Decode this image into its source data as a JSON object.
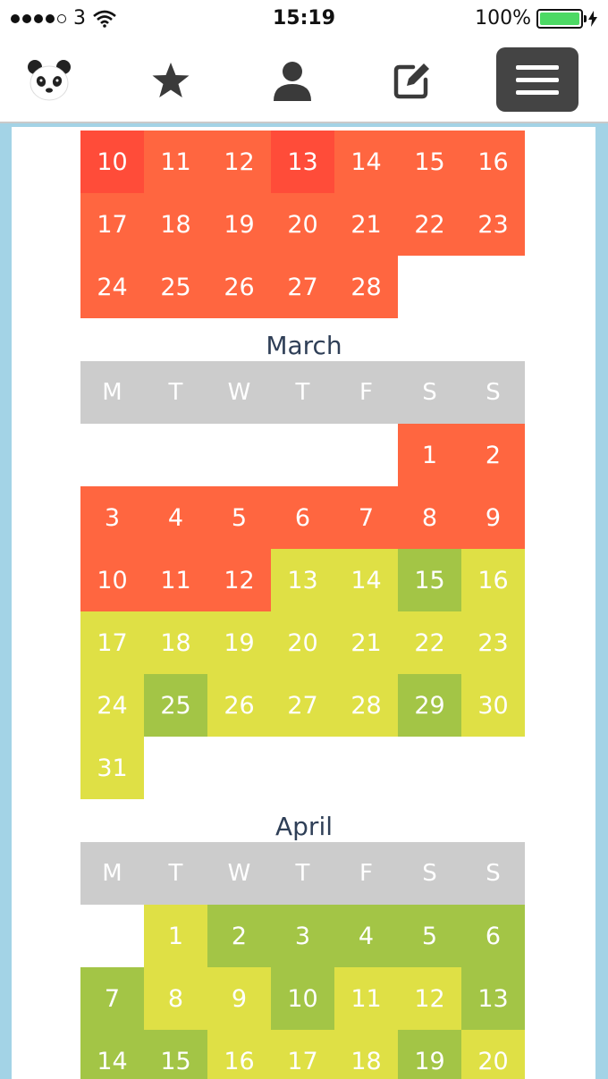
{
  "status_bar": {
    "carrier": "3",
    "time": "15:19",
    "battery": "100%",
    "battery_level": 1.0
  },
  "nav": {
    "items": [
      {
        "name": "panda-logo-icon"
      },
      {
        "name": "star-icon"
      },
      {
        "name": "user-icon"
      },
      {
        "name": "edit-icon"
      },
      {
        "name": "menu-icon"
      }
    ]
  },
  "colors": {
    "red": "#ff6640",
    "dark_red": "#ff4c39",
    "yellow": "#dfe045",
    "green": "#a3c546",
    "header": "#cccccc",
    "frame": "#a3d3e6"
  },
  "weekday_headers": [
    "M",
    "T",
    "W",
    "T",
    "F",
    "S",
    "S"
  ],
  "months": [
    {
      "title": "",
      "show_header": false,
      "rows": [
        [
          {
            "d": "10",
            "c": "dred"
          },
          {
            "d": "11",
            "c": "red"
          },
          {
            "d": "12",
            "c": "red"
          },
          {
            "d": "13",
            "c": "dred"
          },
          {
            "d": "14",
            "c": "red"
          },
          {
            "d": "15",
            "c": "red"
          },
          {
            "d": "16",
            "c": "red"
          }
        ],
        [
          {
            "d": "17",
            "c": "red"
          },
          {
            "d": "18",
            "c": "red"
          },
          {
            "d": "19",
            "c": "red"
          },
          {
            "d": "20",
            "c": "red"
          },
          {
            "d": "21",
            "c": "red"
          },
          {
            "d": "22",
            "c": "red"
          },
          {
            "d": "23",
            "c": "red"
          }
        ],
        [
          {
            "d": "24",
            "c": "red"
          },
          {
            "d": "25",
            "c": "red"
          },
          {
            "d": "26",
            "c": "red"
          },
          {
            "d": "27",
            "c": "red"
          },
          {
            "d": "28",
            "c": "red"
          },
          {
            "d": "",
            "c": "blank"
          },
          {
            "d": "",
            "c": "blank"
          }
        ]
      ]
    },
    {
      "title": "March",
      "show_header": true,
      "rows": [
        [
          {
            "d": "",
            "c": "blank"
          },
          {
            "d": "",
            "c": "blank"
          },
          {
            "d": "",
            "c": "blank"
          },
          {
            "d": "",
            "c": "blank"
          },
          {
            "d": "",
            "c": "blank"
          },
          {
            "d": "1",
            "c": "red"
          },
          {
            "d": "2",
            "c": "red"
          }
        ],
        [
          {
            "d": "3",
            "c": "red"
          },
          {
            "d": "4",
            "c": "red"
          },
          {
            "d": "5",
            "c": "red"
          },
          {
            "d": "6",
            "c": "red"
          },
          {
            "d": "7",
            "c": "red"
          },
          {
            "d": "8",
            "c": "red"
          },
          {
            "d": "9",
            "c": "red"
          }
        ],
        [
          {
            "d": "10",
            "c": "red"
          },
          {
            "d": "11",
            "c": "red"
          },
          {
            "d": "12",
            "c": "red"
          },
          {
            "d": "13",
            "c": "yellow"
          },
          {
            "d": "14",
            "c": "yellow"
          },
          {
            "d": "15",
            "c": "green"
          },
          {
            "d": "16",
            "c": "yellow"
          }
        ],
        [
          {
            "d": "17",
            "c": "yellow"
          },
          {
            "d": "18",
            "c": "yellow"
          },
          {
            "d": "19",
            "c": "yellow"
          },
          {
            "d": "20",
            "c": "yellow"
          },
          {
            "d": "21",
            "c": "yellow"
          },
          {
            "d": "22",
            "c": "yellow"
          },
          {
            "d": "23",
            "c": "yellow"
          }
        ],
        [
          {
            "d": "24",
            "c": "yellow"
          },
          {
            "d": "25",
            "c": "green"
          },
          {
            "d": "26",
            "c": "yellow"
          },
          {
            "d": "27",
            "c": "yellow"
          },
          {
            "d": "28",
            "c": "yellow"
          },
          {
            "d": "29",
            "c": "green"
          },
          {
            "d": "30",
            "c": "yellow"
          }
        ],
        [
          {
            "d": "31",
            "c": "yellow"
          },
          {
            "d": "",
            "c": "blank"
          },
          {
            "d": "",
            "c": "blank"
          },
          {
            "d": "",
            "c": "blank"
          },
          {
            "d": "",
            "c": "blank"
          },
          {
            "d": "",
            "c": "blank"
          },
          {
            "d": "",
            "c": "blank"
          }
        ]
      ]
    },
    {
      "title": "April",
      "show_header": true,
      "rows": [
        [
          {
            "d": "",
            "c": "blank"
          },
          {
            "d": "1",
            "c": "yellow"
          },
          {
            "d": "2",
            "c": "green"
          },
          {
            "d": "3",
            "c": "green"
          },
          {
            "d": "4",
            "c": "green"
          },
          {
            "d": "5",
            "c": "green"
          },
          {
            "d": "6",
            "c": "green"
          }
        ],
        [
          {
            "d": "7",
            "c": "green"
          },
          {
            "d": "8",
            "c": "yellow"
          },
          {
            "d": "9",
            "c": "yellow"
          },
          {
            "d": "10",
            "c": "green"
          },
          {
            "d": "11",
            "c": "yellow"
          },
          {
            "d": "12",
            "c": "yellow"
          },
          {
            "d": "13",
            "c": "green"
          }
        ],
        [
          {
            "d": "14",
            "c": "green"
          },
          {
            "d": "15",
            "c": "green"
          },
          {
            "d": "16",
            "c": "yellow"
          },
          {
            "d": "17",
            "c": "yellow"
          },
          {
            "d": "18",
            "c": "yellow"
          },
          {
            "d": "19",
            "c": "green"
          },
          {
            "d": "20",
            "c": "yellow"
          }
        ]
      ]
    }
  ]
}
